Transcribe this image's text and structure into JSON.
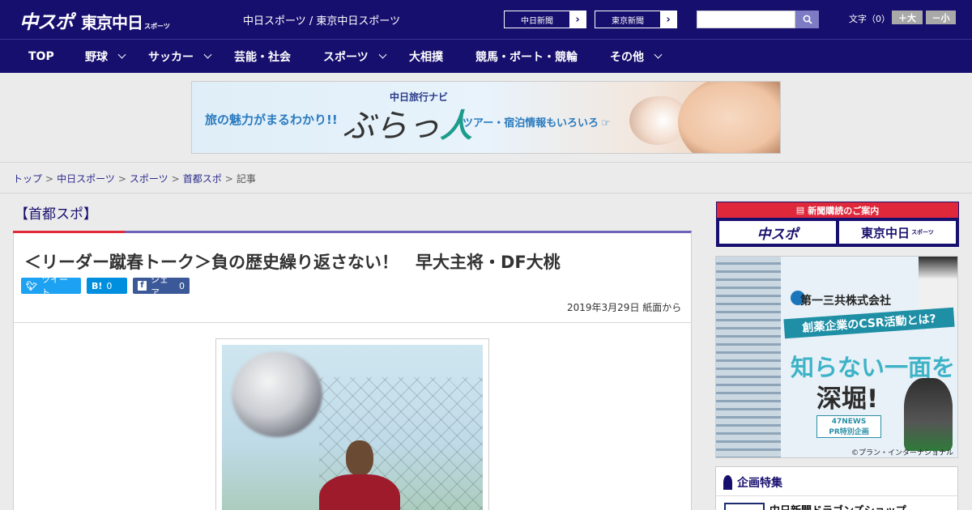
{
  "header": {
    "logo_chunichi": "中スポ",
    "logo_tokyo": "東京中日",
    "logo_sub": "スポーツ",
    "site_links": "中日スポーツ / 東京中日スポーツ",
    "ext_links": [
      {
        "label": "中日新聞",
        "arrow": "›"
      },
      {
        "label": "東京新聞",
        "arrow": "›"
      }
    ],
    "search": {
      "placeholder": "",
      "icon": "search-icon"
    },
    "font_size": {
      "label": "文字（0）",
      "increase": "＋大",
      "decrease": "－小"
    }
  },
  "nav": {
    "items": [
      {
        "label": "TOP",
        "has_menu": false
      },
      {
        "label": "野球",
        "has_menu": true
      },
      {
        "label": "サッカー",
        "has_menu": true
      },
      {
        "label": "芸能・社会",
        "has_menu": false
      },
      {
        "label": "スポーツ",
        "has_menu": true
      },
      {
        "label": "大相撲",
        "has_menu": false
      },
      {
        "label": "競馬・ボート・競輪",
        "has_menu": false
      },
      {
        "label": "その他",
        "has_menu": true
      }
    ]
  },
  "banner_ad": {
    "left_text": "旅の魅力がまるわかり!!",
    "navi": "中日旅行ナビ",
    "brand_a": "ぶらっ",
    "brand_b": "人",
    "right_text": "ツアー・宿泊情報もいろいろ"
  },
  "breadcrumb": {
    "items": [
      "トップ",
      "中日スポーツ",
      "スポーツ",
      "首都スポ",
      "記事"
    ],
    "separator": ">"
  },
  "article": {
    "category": "【首都スポ】",
    "headline": "＜リーダー蹴春トーク＞負の歴史繰り返さない！　早大主将・DF大桃",
    "share": {
      "tweet": "ツイート",
      "hatena_label": "B!",
      "hatena_count": "0",
      "fb_label": "シェア",
      "fb_count": "0"
    },
    "dateline": "2019年3月29日 紙面から"
  },
  "sidebar": {
    "subscribe": {
      "heading": "新聞購読のご案内",
      "logo_a": "中スポ",
      "logo_b": "東京中日",
      "logo_b_sub": "スポーツ"
    },
    "ad": {
      "company": "第一三共株式会社",
      "ribbon": "創薬企業のCSR活動とは?",
      "headline1": "知らない一面を",
      "headline2": "深堀!",
      "pr_line1": "47NEWS",
      "pr_line2": "PR特別企画",
      "credit": "©プラン・インターナショナル"
    },
    "features": {
      "heading": "企画特集",
      "item": "中日新聞ドラゴンズショップ"
    }
  },
  "colors": {
    "brand_navy": "#170f6e",
    "accent_red": "#e02a3a",
    "accent_purple": "#6d64b8"
  }
}
